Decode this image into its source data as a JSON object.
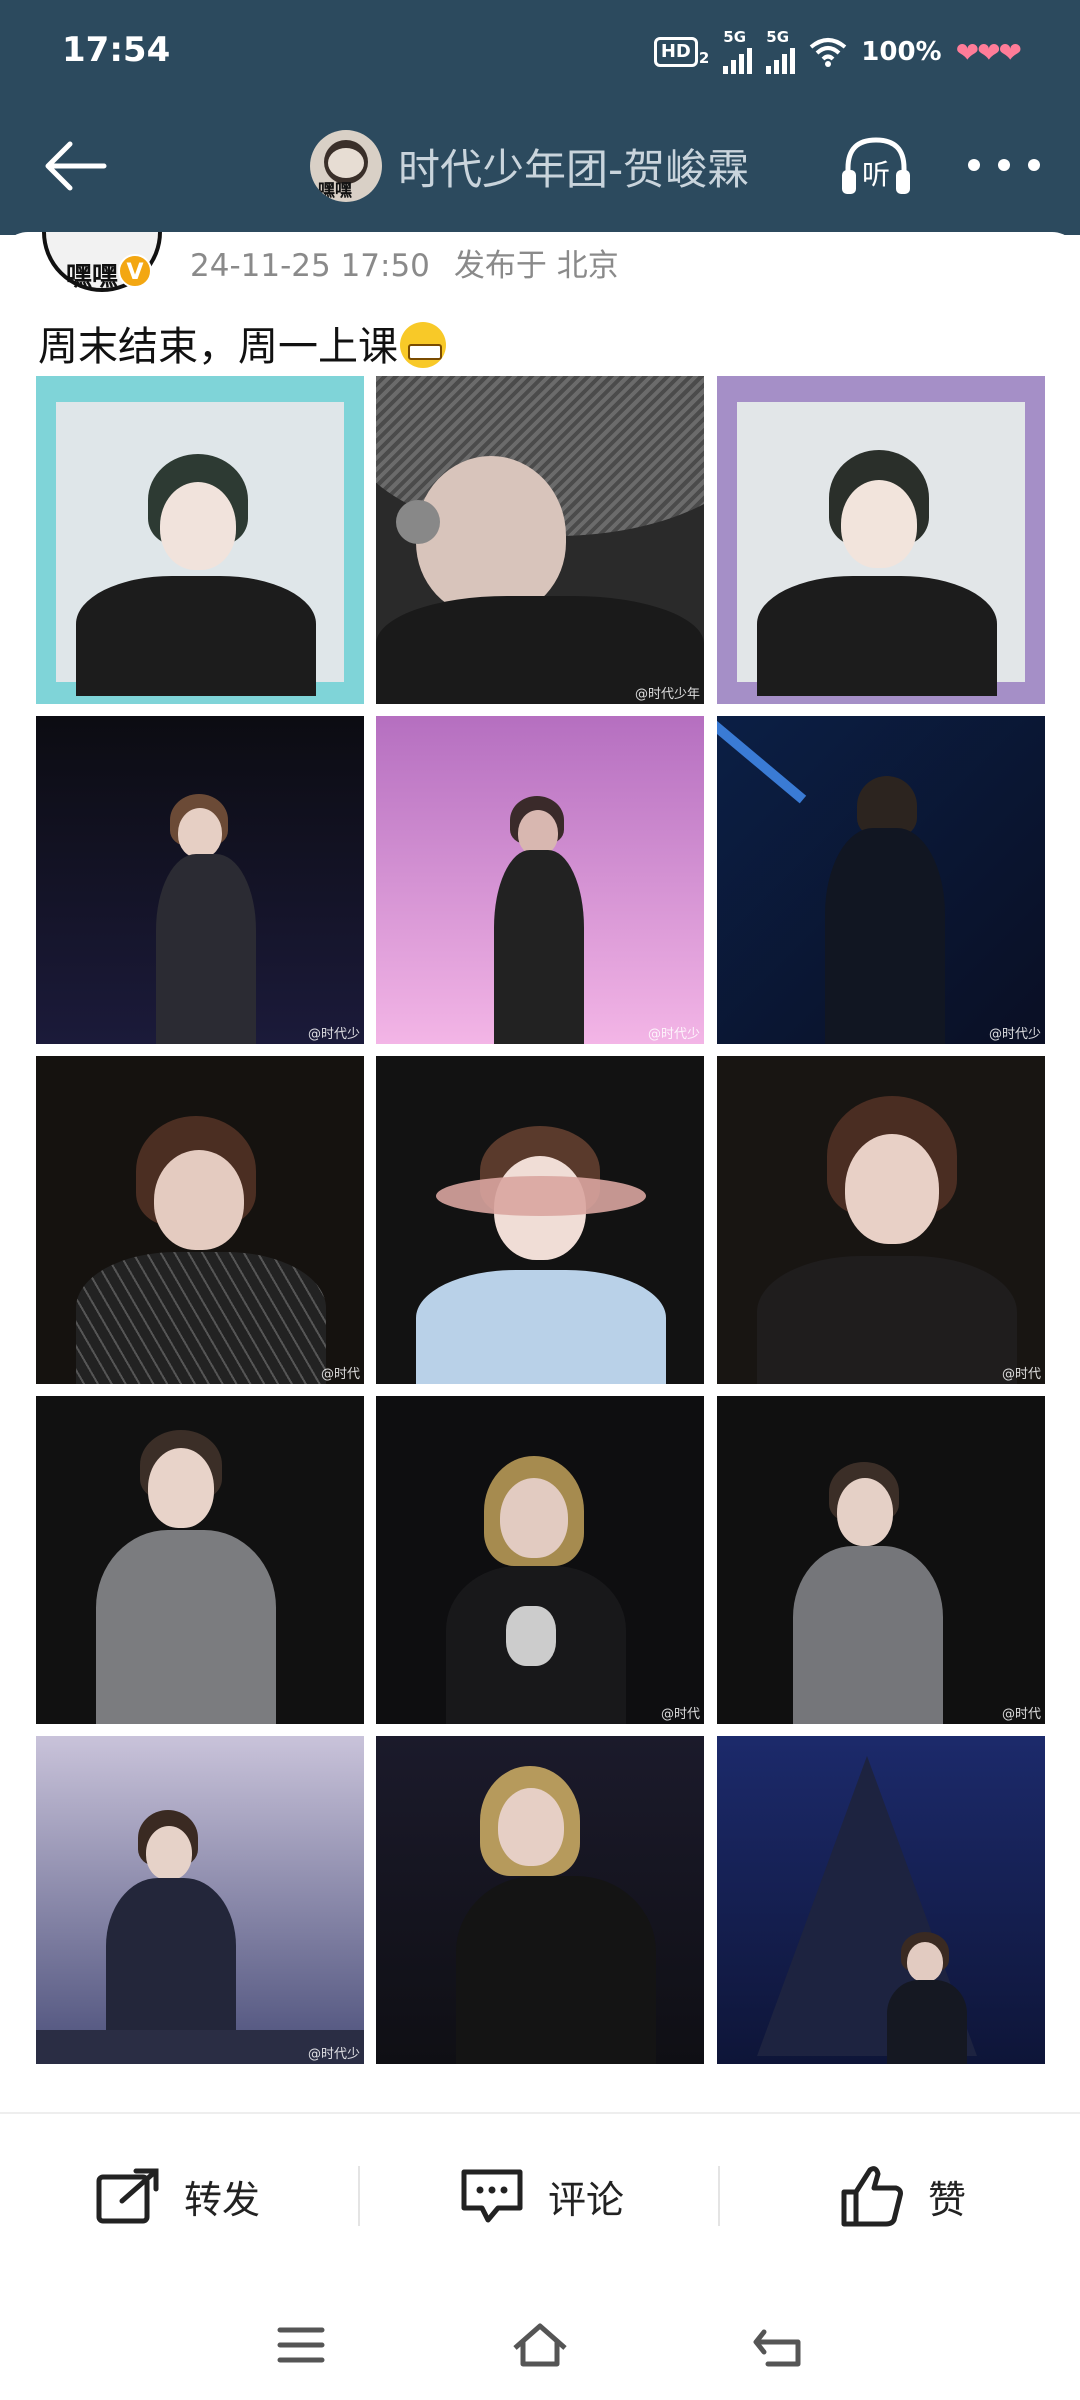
{
  "status_bar": {
    "time": "17:54",
    "hd_label": "HD",
    "hd_sub": "2",
    "net1": "5G",
    "net2": "5G",
    "battery": "100%",
    "hearts": "❤❤❤"
  },
  "nav": {
    "title": "时代少年团-贺峻霖",
    "avatar_text": "嘿嘿",
    "listen_label": "听",
    "colors": {
      "bar_bg": "#2c4a5e",
      "title": "#c9d4dc"
    }
  },
  "post": {
    "author_avatar_text": "嘿嘿",
    "verified_badge": "V",
    "timestamp": "24-11-25 17:50",
    "location": "发布于 北京",
    "text": "周末结束，周一上课",
    "emoji": "grinning-face-emoji"
  },
  "photos": [
    {
      "name": "photo-polaroid-teal",
      "watermark": ""
    },
    {
      "name": "photo-hat-microphone",
      "watermark": "@时代少年"
    },
    {
      "name": "photo-polaroid-pink",
      "watermark": ""
    },
    {
      "name": "photo-stage-dancing",
      "watermark": "@时代少"
    },
    {
      "name": "photo-pink-light",
      "watermark": "@时代少"
    },
    {
      "name": "photo-blue-back",
      "watermark": "@时代少"
    },
    {
      "name": "photo-sequin-jacket",
      "watermark": "@时代"
    },
    {
      "name": "photo-crystal-mask",
      "watermark": ""
    },
    {
      "name": "photo-touching-face",
      "watermark": "@时代"
    },
    {
      "name": "photo-grey-sweater",
      "watermark": ""
    },
    {
      "name": "photo-costume-plush",
      "watermark": "@时代"
    },
    {
      "name": "photo-grey-sweater-2",
      "watermark": "@时代"
    },
    {
      "name": "photo-sitting-suit",
      "watermark": "@时代少"
    },
    {
      "name": "photo-stage-pointing",
      "watermark": ""
    },
    {
      "name": "photo-snow-tree",
      "watermark": ""
    }
  ],
  "actions": {
    "repost": "转发",
    "comment": "评论",
    "like": "赞"
  }
}
